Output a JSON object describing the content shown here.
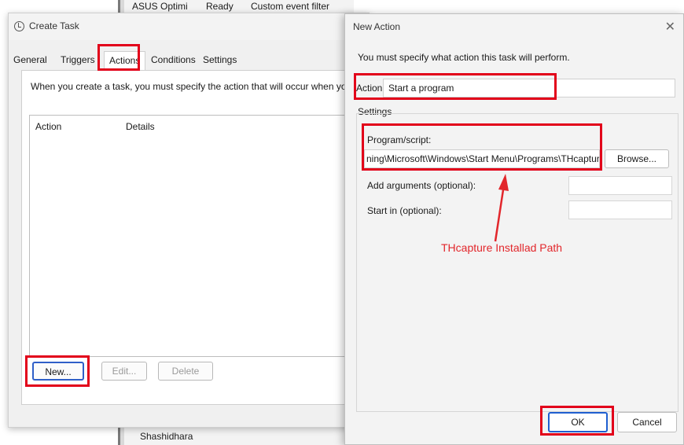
{
  "background": {
    "top_items": [
      "ASUS Optimi",
      "Ready",
      "Custom event filter"
    ],
    "bottom_item": "Shashidhara"
  },
  "create_task": {
    "title": "Create Task",
    "tabs": [
      "General",
      "Triggers",
      "Actions",
      "Conditions",
      "Settings"
    ],
    "active_tab": "Actions",
    "description": "When you create a task, you must specify the action that will occur when your",
    "columns": [
      "Action",
      "Details"
    ],
    "buttons": {
      "new": "New...",
      "edit": "Edit...",
      "delete": "Delete"
    }
  },
  "new_action": {
    "title": "New Action",
    "close": "✕",
    "instruction": "You must specify what action this task will perform.",
    "action_label": "Action:",
    "action_value": "Start a program",
    "settings_label": "Settings",
    "program_label": "Program/script:",
    "program_value": "ning\\Microsoft\\Windows\\Start Menu\\Programs\\THcapture",
    "browse": "Browse...",
    "arguments_label": "Add arguments (optional):",
    "start_in_label": "Start in (optional):",
    "ok": "OK",
    "cancel": "Cancel"
  },
  "annotation": {
    "text": "THcapture Installad Path",
    "color": "#e2262b"
  },
  "icons": [
    "clock-icon",
    "close-icon",
    "chevron-down-icon"
  ]
}
